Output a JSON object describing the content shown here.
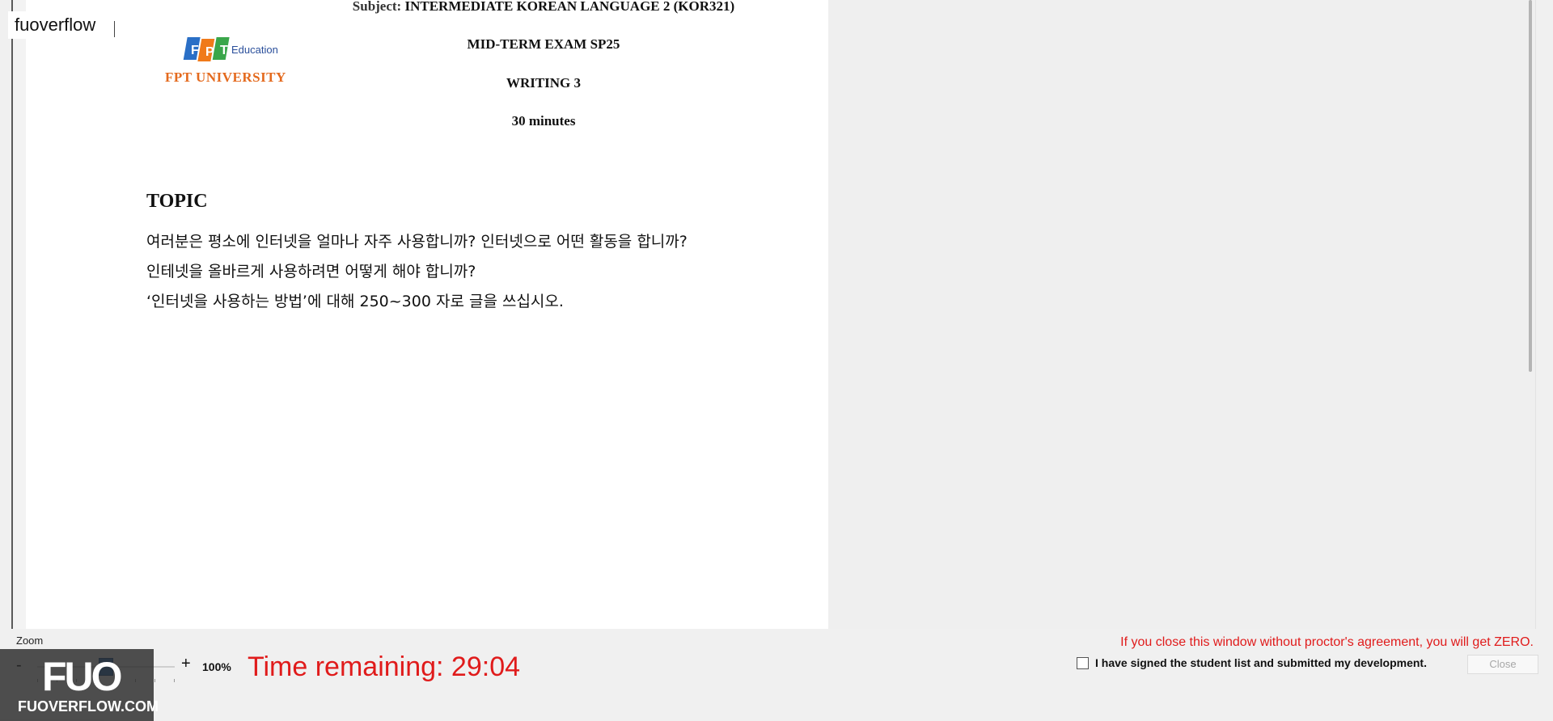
{
  "watermark": {
    "label": "fuoverflow",
    "footer_brand": "FUO",
    "footer_site": "FUOVERFLOW.COM"
  },
  "exam": {
    "subject_prefix": "Subject:",
    "subject": "INTERMEDIATE KOREAN LANGUAGE 2 (KOR321)",
    "logo_education": "Education",
    "logo_university": "FPT UNIVERSITY",
    "exam_name": "MID-TERM EXAM SP25",
    "section": "WRITING 3",
    "duration": "30 minutes",
    "topic_heading": "TOPIC",
    "question_lines": [
      "여러분은 평소에 인터넷을 얼마나 자주 사용합니까? 인터넷으로 어떤 활동을 합니까?",
      "인테넷을 올바르게 사용하려면 어떻게 해야 합니까?",
      "‘인터넷을 사용하는 방법’에 대해 250~300 자로 글을 쓰십시오."
    ]
  },
  "zoom": {
    "label": "Zoom",
    "minus": "-",
    "plus": "+",
    "value": "100%"
  },
  "timer": {
    "text": "Time remaining: 29:04"
  },
  "footer": {
    "warning": "If you close this window without proctor's agreement, you will get ZERO.",
    "agreement_label": "I have signed the student list and submitted my development.",
    "agreement_checked": false,
    "close_label": "Close"
  },
  "colors": {
    "warning_red": "#e01b1b",
    "logo_orange": "#e46a1e",
    "logo_blue": "#2a4f9b"
  }
}
